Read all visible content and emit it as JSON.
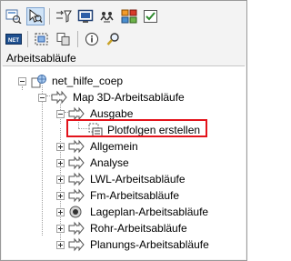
{
  "panel": {
    "section_title": "Arbeitsabläufe"
  },
  "toolbar": {
    "row1": [
      {
        "icon": "view-properties-icon"
      },
      {
        "icon": "select-tool-icon",
        "active": true
      },
      {
        "icon": "filter-icon"
      },
      {
        "icon": "monitor-icon"
      },
      {
        "icon": "people-network-icon"
      },
      {
        "icon": "workflow-grid-icon"
      },
      {
        "icon": "checklist-icon"
      }
    ],
    "row2": [
      {
        "icon": "net-logo-icon"
      },
      {
        "icon": "dashed-select-icon"
      },
      {
        "icon": "copy-icon"
      },
      {
        "icon": "info-icon"
      },
      {
        "icon": "search-icon"
      }
    ]
  },
  "tree": {
    "root": "net_hilfe_coep",
    "map3d": "Map 3D-Arbeitsabläufe",
    "ausgabe": "Ausgabe",
    "plotfolgen": "Plotfolgen erstellen",
    "allgemein": "Allgemein",
    "analyse": "Analyse",
    "lwl": "LWL-Arbeitsabläufe",
    "fm": "Fm-Arbeitsabläufe",
    "lageplan": "Lageplan-Arbeitsabläufe",
    "rohr": "Rohr-Arbeitsabläufe",
    "planungs": "Planungs-Arbeitsabläufe"
  },
  "colors": {
    "highlight": "#e3131b",
    "selection": "#cfe3f7"
  }
}
